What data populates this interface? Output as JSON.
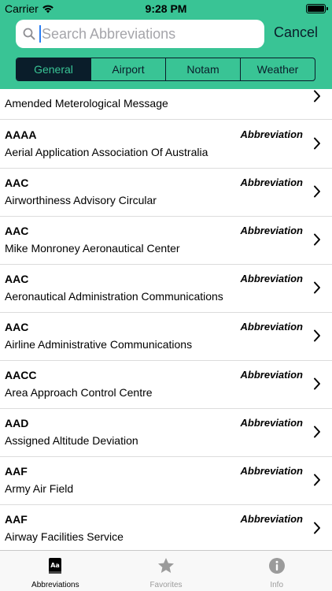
{
  "status_bar": {
    "carrier": "Carrier",
    "time": "9:28 PM"
  },
  "search": {
    "placeholder": "Search Abbreviations",
    "value": "",
    "cancel_label": "Cancel"
  },
  "segments": [
    {
      "label": "General",
      "active": true
    },
    {
      "label": "Airport",
      "active": false
    },
    {
      "label": "Notam",
      "active": false
    },
    {
      "label": "Weather",
      "active": false
    }
  ],
  "partial_row": {
    "description": "Amended Meterological Message"
  },
  "rows": [
    {
      "abbr": "AAAA",
      "kind": "Abbreviation",
      "description": "Aerial Application Association Of Australia"
    },
    {
      "abbr": "AAC",
      "kind": "Abbreviation",
      "description": "Airworthiness Advisory Circular"
    },
    {
      "abbr": "AAC",
      "kind": "Abbreviation",
      "description": "Mike Monroney Aeronautical Center"
    },
    {
      "abbr": "AAC",
      "kind": "Abbreviation",
      "description": "Aeronautical Administration Communications"
    },
    {
      "abbr": "AAC",
      "kind": "Abbreviation",
      "description": "Airline Administrative Communications"
    },
    {
      "abbr": "AACC",
      "kind": "Abbreviation",
      "description": "Area Approach Control Centre"
    },
    {
      "abbr": "AAD",
      "kind": "Abbreviation",
      "description": "Assigned Altitude Deviation"
    },
    {
      "abbr": "AAF",
      "kind": "Abbreviation",
      "description": "Army Air Field"
    },
    {
      "abbr": "AAF",
      "kind": "Abbreviation",
      "description": "Airway Facilities Service"
    }
  ],
  "tabbar": {
    "abbreviations": {
      "label": "Abbreviations",
      "icon": "dictionary-icon",
      "active": true
    },
    "favorites": {
      "label": "Favorites",
      "icon": "star-icon",
      "active": false
    },
    "info": {
      "label": "Info",
      "icon": "info-icon",
      "active": false
    }
  },
  "colors": {
    "header": "#39c495",
    "dark": "#0a1d2a",
    "caret": "#2a7df2"
  }
}
